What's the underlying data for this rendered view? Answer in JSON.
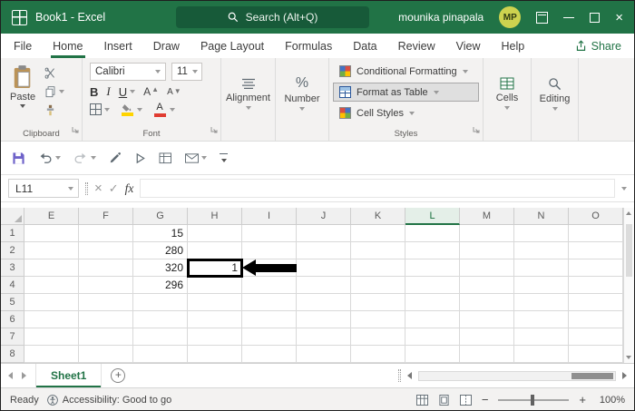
{
  "titlebar": {
    "title": "Book1 - Excel",
    "search_placeholder": "Search (Alt+Q)",
    "user_name": "mounika pinapala",
    "user_initials": "MP",
    "close_glyph": "×"
  },
  "menubar": {
    "tabs": [
      "File",
      "Home",
      "Insert",
      "Draw",
      "Page Layout",
      "Formulas",
      "Data",
      "Review",
      "View",
      "Help"
    ],
    "active_tab": "Home",
    "share_label": "Share"
  },
  "ribbon": {
    "clipboard": {
      "group_label": "Clipboard",
      "paste_label": "Paste"
    },
    "font": {
      "group_label": "Font",
      "font_name": "Calibri",
      "font_size": "11",
      "bold_glyph": "B",
      "italic_glyph": "I",
      "underline_glyph": "U",
      "grow_font_glyph": "A",
      "shrink_font_glyph": "A",
      "font_color_glyph": "A"
    },
    "alignment": {
      "group_label": "Alignment"
    },
    "number": {
      "group_label": "Number",
      "percent_glyph": "%"
    },
    "styles": {
      "group_label": "Styles",
      "conditional_formatting_label": "Conditional Formatting",
      "format_as_table_label": "Format as Table",
      "cell_styles_label": "Cell Styles"
    },
    "cells": {
      "group_label": "Cells"
    },
    "editing": {
      "group_label": "Editing"
    }
  },
  "formula_bar": {
    "name_box_value": "L11",
    "cancel_glyph": "×",
    "enter_glyph": "✓",
    "fx_label": "fx",
    "formula_value": ""
  },
  "grid": {
    "column_headers": [
      "E",
      "F",
      "G",
      "H",
      "I",
      "J",
      "K",
      "L",
      "M",
      "N",
      "O"
    ],
    "highlighted_column": "L",
    "row_headers": [
      "1",
      "2",
      "3",
      "4",
      "5",
      "6",
      "7",
      "8"
    ],
    "cell_values": {
      "G1": "15",
      "G2": "280",
      "G3": "320",
      "G4": "296",
      "H3": "1"
    },
    "selected_cell": "H3"
  },
  "sheet_bar": {
    "active_sheet": "Sheet1",
    "add_glyph": "+"
  },
  "status_bar": {
    "mode": "Ready",
    "accessibility_text": "Accessibility: Good to go",
    "zoom_out_glyph": "−",
    "zoom_in_glyph": "+",
    "zoom_level": "100%"
  }
}
